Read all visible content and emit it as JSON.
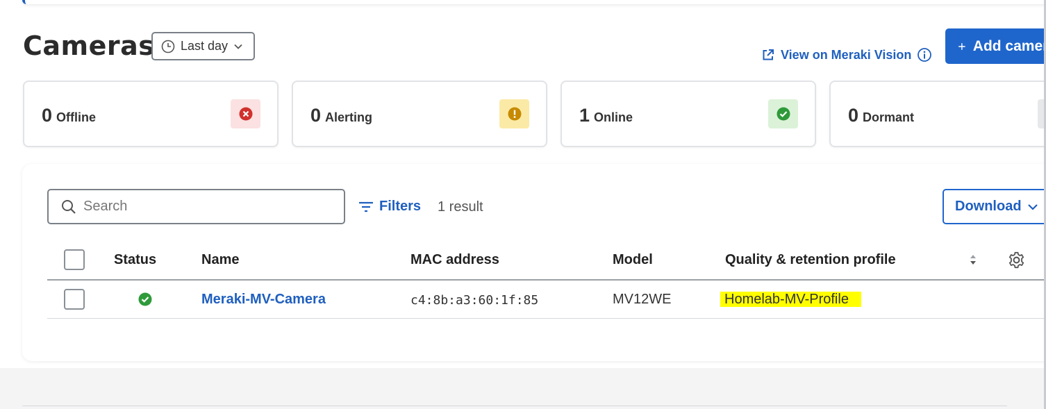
{
  "page": {
    "title": "Cameras"
  },
  "time_filter": {
    "selected": "Last day"
  },
  "links": {
    "view_on_vision": "View on Meraki Vision"
  },
  "actions": {
    "add_camera": "Add camera",
    "download": "Download",
    "filters": "Filters"
  },
  "stats": [
    {
      "count": "0",
      "label": "Offline",
      "icon": "x-circle-icon",
      "color": "#d0312d",
      "bg": "#fbe1e1"
    },
    {
      "count": "0",
      "label": "Alerting",
      "icon": "exclamation-circle-icon",
      "color": "#c78a00",
      "bg": "#fbeaa6"
    },
    {
      "count": "1",
      "label": "Online",
      "icon": "check-circle-icon",
      "color": "#2f9a3a",
      "bg": "#dbf2d8"
    },
    {
      "count": "0",
      "label": "Dormant",
      "icon": "dormant-icon",
      "color": "#8a9097",
      "bg": "#e6e8ea"
    }
  ],
  "search": {
    "placeholder": "Search",
    "value": ""
  },
  "result_count": "1 result",
  "table": {
    "columns": [
      "Status",
      "Name",
      "MAC address",
      "Model",
      "Quality & retention profile"
    ],
    "rows": [
      {
        "status": "online",
        "name": "Meraki-MV-Camera",
        "mac": "c4:8b:a3:60:1f:85",
        "model": "MV12WE",
        "profile": "Homelab-MV-Profile"
      }
    ]
  },
  "colors": {
    "accent": "#1f66cc",
    "online": "#2f9a3a",
    "highlight": "#ffff00"
  }
}
